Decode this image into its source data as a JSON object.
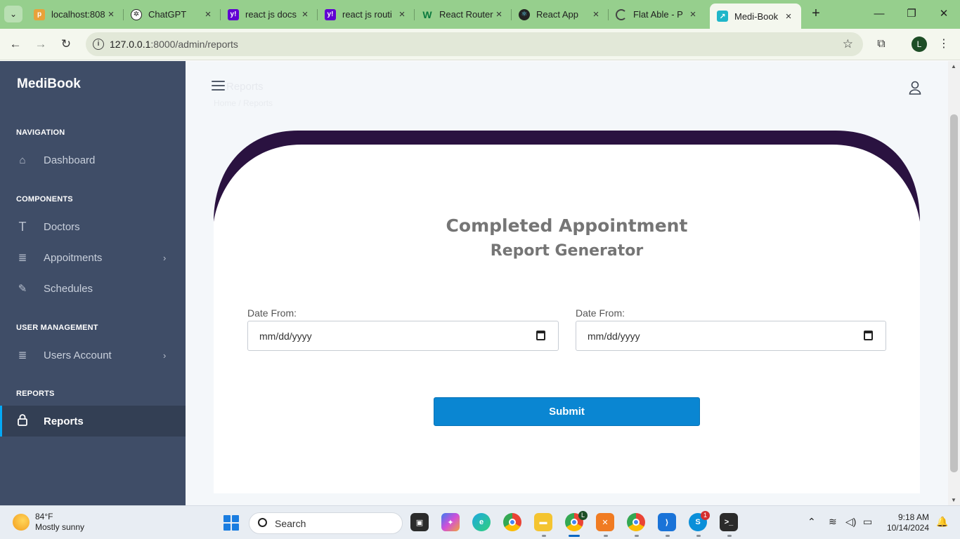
{
  "browser": {
    "tabs": [
      {
        "title": "localhost:808",
        "icon": "phpmyadmin-icon"
      },
      {
        "title": "ChatGPT",
        "icon": "chatgpt-icon"
      },
      {
        "title": "react js docs",
        "icon": "yahoo-icon"
      },
      {
        "title": "react js routi",
        "icon": "yahoo-icon"
      },
      {
        "title": "React Router",
        "icon": "w-icon"
      },
      {
        "title": "React App",
        "icon": "react-icon"
      },
      {
        "title": "Flat Able - P",
        "icon": "loading-icon"
      },
      {
        "title": "Medi-Book",
        "icon": "chart-icon"
      }
    ],
    "active_tab": 7,
    "url_host": "127.0.0.1",
    "url_rest": ":8000/admin/reports",
    "profile_initial": "L"
  },
  "sidebar": {
    "brand": "MediBook",
    "sections": {
      "navigation": "NAVIGATION",
      "components": "COMPONENTS",
      "user_management": "USER MANAGEMENT",
      "reports": "REPORTS"
    },
    "items": {
      "dashboard": "Dashboard",
      "doctors": "Doctors",
      "appointments": "Appoitments",
      "schedules": "Schedules",
      "users_account": "Users Account",
      "reports": "Reports"
    }
  },
  "main": {
    "ghost_title": "Reports",
    "ghost_breadcrumb": "Home  /  Reports",
    "report_title_line1": "Completed Appointment",
    "report_title_line2": "Report Generator",
    "date_from_label": "Date From:",
    "date_to_label": "Date From:",
    "date_placeholder": "mm/dd/yyyy",
    "submit_label": "Submit"
  },
  "taskbar": {
    "weather_temp": "84°F",
    "weather_desc": "Mostly sunny",
    "search_label": "Search",
    "time": "9:18 AM",
    "date": "10/14/2024",
    "chrome_profile_badge": "L",
    "skype_badge": "1"
  },
  "colors": {
    "sidebar": "#3f4d67",
    "accent": "#04a9f5",
    "card_arc": "#2a1240",
    "submit": "#0a86d2",
    "browser_frame": "#96cf8d"
  }
}
